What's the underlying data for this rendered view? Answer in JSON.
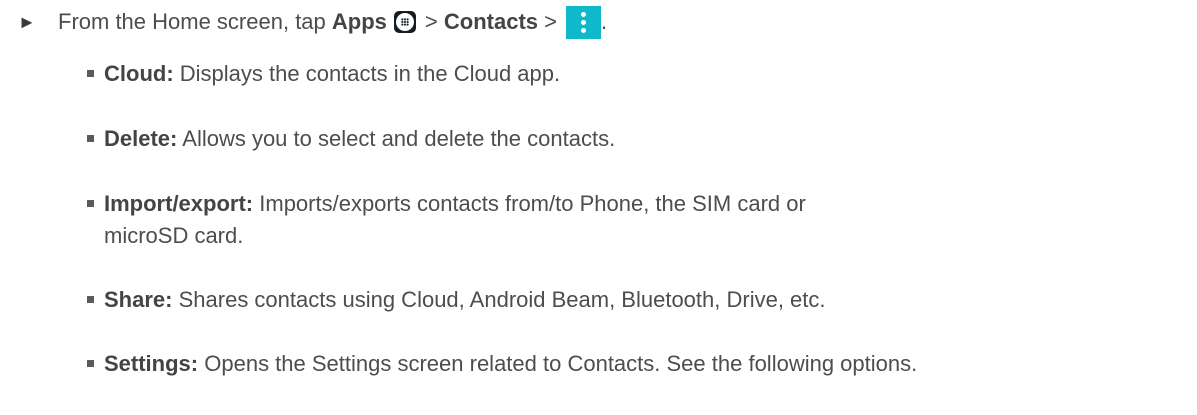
{
  "instruction": {
    "arrow_glyph": "►",
    "prefix": "From the Home screen, tap",
    "apps_label": "Apps",
    "separator_1": ">",
    "contacts_label": "Contacts",
    "separator_2": ">",
    "suffix": "."
  },
  "items": [
    {
      "term": "Cloud:",
      "text": "Displays the contacts in the Cloud app."
    },
    {
      "term": "Delete:",
      "text": "Allows you to select and delete the contacts."
    },
    {
      "term": "Import/export:",
      "text": "Imports/exports contacts from/to Phone, the SIM card or microSD card."
    },
    {
      "term": "Share:",
      "text": "Shares contacts using Cloud, Android Beam, Bluetooth, Drive, etc."
    },
    {
      "term": "Settings:",
      "text": "Opens the Settings screen related to Contacts. See the following options."
    }
  ],
  "icons": {
    "apps": "apps-grid-icon",
    "menu": "overflow-menu-icon"
  },
  "colors": {
    "text": "#4d4d4d",
    "menu_icon_bg": "#10b8cc",
    "apps_icon_bg": "#151c22"
  }
}
